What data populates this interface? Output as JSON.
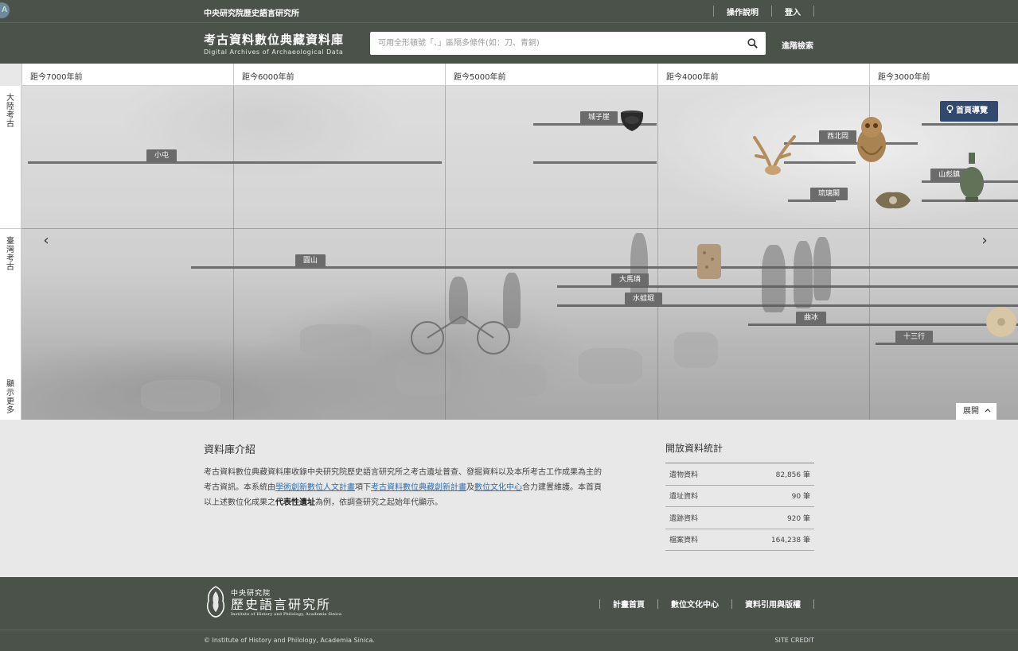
{
  "topbar": {
    "institute": "中央研究院歷史語言研究所",
    "links": [
      "操作說明",
      "登入"
    ],
    "corner_icon_glyph": "A"
  },
  "header": {
    "logo_title": "考古資料數位典藏資料庫",
    "logo_subtitle": "Digital Archives of Archaeological Data",
    "search_placeholder": "可用全形頓號「、」區隔多條件(如：刀、青銅)",
    "advanced_search": "進階檢索"
  },
  "timeline": {
    "ticks": [
      "距今7000年前",
      "距今6000年前",
      "距今5000年前",
      "距今4000年前",
      "距今3000年前"
    ],
    "sidebar": {
      "mainland": "大陸考古",
      "taiwan": "臺灣考古",
      "show_more": "顯示更多"
    },
    "sites": [
      "城子崖",
      "西北岡",
      "小屯",
      "山彪鎮",
      "琉璃閣",
      "圓山",
      "大馬璘",
      "水蛙堀",
      "曲冰",
      "十三行"
    ],
    "guide_button": "首頁導覽",
    "expand_button": "展開",
    "prev_arrow": "‹",
    "next_arrow": "›"
  },
  "about": {
    "title": "資料庫介紹",
    "text_1": "考古資料數位典藏資料庫收錄中央研究院歷史語言研究所之考古遺址普查、發掘資料以及本所考古工作成果為主的考古資訊。本系統由",
    "link_1": "學術創新數位人文計畫",
    "text_2": "項下",
    "link_2": "考古資料數位典藏創新計畫",
    "text_3": "及",
    "link_3": "數位文化中心",
    "text_4": "合力建置維護。本首頁以上述數位化成果之",
    "bold_1": "代表性遺址",
    "text_5": "為例，依調查研究之起始年代顯示。"
  },
  "stats": {
    "title": "開放資料統計",
    "rows": [
      {
        "label": "遺物資料",
        "value": "82,856 筆"
      },
      {
        "label": "遺址資料",
        "value": "90 筆"
      },
      {
        "label": "遺跡資料",
        "value": "920 筆"
      },
      {
        "label": "檔案資料",
        "value": "164,238 筆"
      }
    ]
  },
  "footer": {
    "logo_line1": "中央研究院",
    "logo_line2": "歷史語言研究所",
    "logo_line3": "Institute of History and Philology, Academia Sinica",
    "links": [
      "計畫首頁",
      "數位文化中心",
      "資料引用與版權"
    ],
    "copyright": "© Institute of History and Philology, Academia Sinica.",
    "credit": "SITE CREDIT"
  },
  "colors": {
    "header_bg": "#4a524a",
    "guide_bg": "#2f4a6e",
    "link": "#2f6fb0",
    "site_tag": "#6b6b6b"
  }
}
